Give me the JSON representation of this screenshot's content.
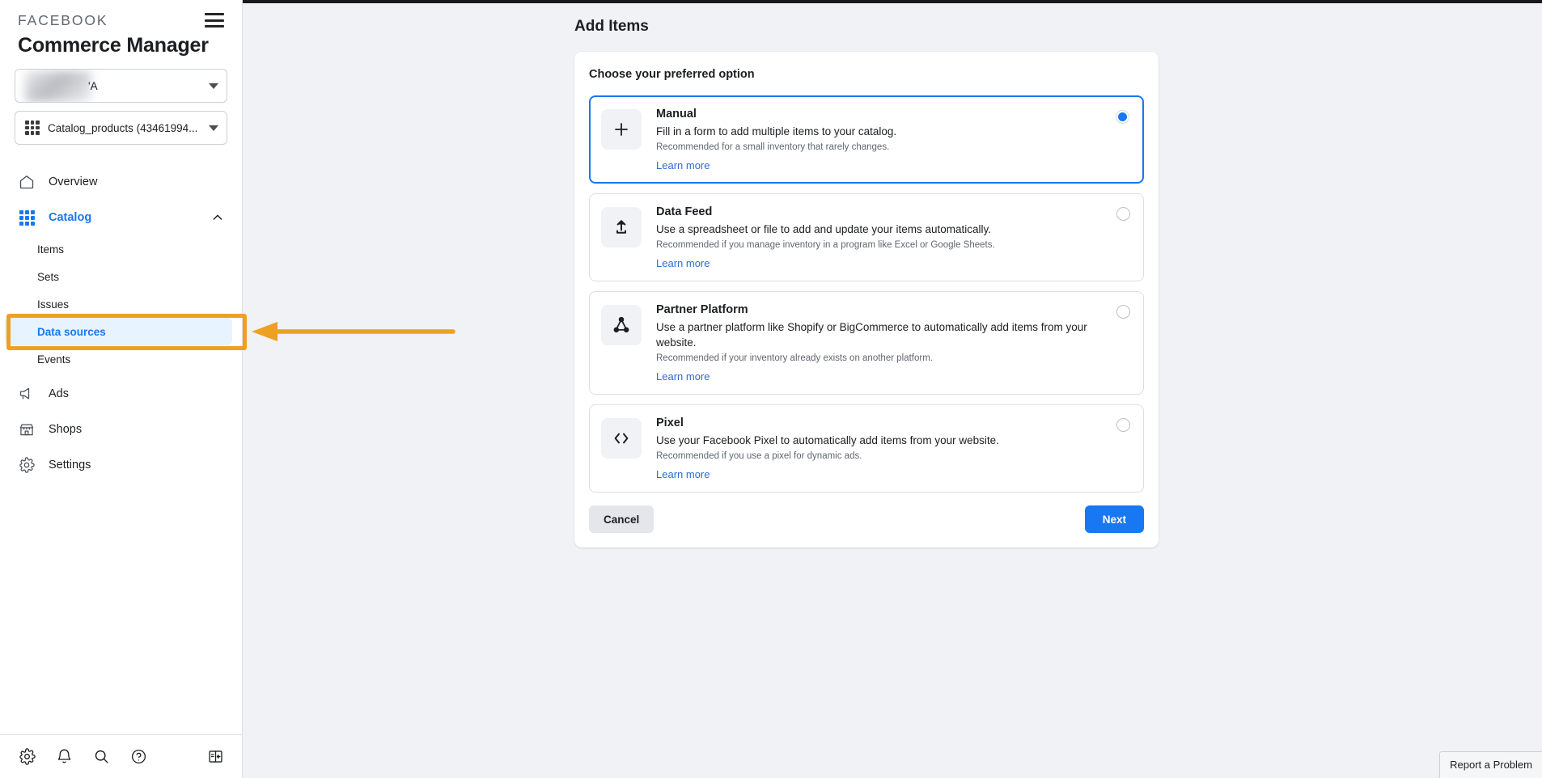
{
  "sidebar": {
    "brand": "FACEBOOK",
    "app_title": "Commerce Manager",
    "menu_icon": "hamburger-icon",
    "account_selector": {
      "value": "'A",
      "icon": "avatar-blurred"
    },
    "catalog_selector": {
      "value": "Catalog_products (43461994...",
      "icon": "grid-icon"
    },
    "nav": [
      {
        "label": "Overview",
        "icon": "home-icon",
        "active": false
      },
      {
        "label": "Catalog",
        "icon": "grid-icon",
        "active": true,
        "expanded": true,
        "chevron": "chevron-up-icon"
      },
      {
        "label": "Ads",
        "icon": "megaphone-icon",
        "active": false
      },
      {
        "label": "Shops",
        "icon": "storefront-icon",
        "active": false
      },
      {
        "label": "Settings",
        "icon": "gear-icon",
        "active": false
      }
    ],
    "catalog_subnav": [
      {
        "label": "Items",
        "selected": false
      },
      {
        "label": "Sets",
        "selected": false
      },
      {
        "label": "Issues",
        "selected": false
      },
      {
        "label": "Data sources",
        "selected": true
      },
      {
        "label": "Events",
        "selected": false
      }
    ],
    "footer_icons": [
      {
        "name": "gear-icon"
      },
      {
        "name": "bell-icon"
      },
      {
        "name": "search-icon"
      },
      {
        "name": "help-circle-icon"
      },
      {
        "name": "collapse-panel-icon"
      }
    ]
  },
  "main": {
    "page_title": "Add Items",
    "card_heading": "Choose your preferred option",
    "options": [
      {
        "id": "manual",
        "title": "Manual",
        "description": "Fill in a form to add multiple items to your catalog.",
        "recommendation": "Recommended for a small inventory that rarely changes.",
        "learn_more": "Learn more",
        "icon": "plus-icon",
        "selected": true
      },
      {
        "id": "data-feed",
        "title": "Data Feed",
        "description": "Use a spreadsheet or file to add and update your items automatically.",
        "recommendation": "Recommended if you manage inventory in a program like Excel or Google Sheets.",
        "learn_more": "Learn more",
        "icon": "upload-icon",
        "selected": false
      },
      {
        "id": "partner-platform",
        "title": "Partner Platform",
        "description": "Use a partner platform like Shopify or BigCommerce to automatically add items from your website.",
        "recommendation": "Recommended if your inventory already exists on another platform.",
        "learn_more": "Learn more",
        "icon": "network-nodes-icon",
        "selected": false
      },
      {
        "id": "pixel",
        "title": "Pixel",
        "description": "Use your Facebook Pixel to automatically add items from your website.",
        "recommendation": "Recommended if you use a pixel for dynamic ads.",
        "learn_more": "Learn more",
        "icon": "code-brackets-icon",
        "selected": false
      }
    ],
    "cancel_label": "Cancel",
    "next_label": "Next"
  },
  "footer": {
    "report_label": "Report a Problem"
  },
  "annotation": {
    "color": "#eda023",
    "target": "Data sources"
  },
  "colors": {
    "accent_blue": "#1877f2",
    "link_blue": "#2d6bd4",
    "selected_row_bg": "#e7f3ff",
    "page_bg": "#f0f2f5",
    "annotation_orange": "#eda023"
  }
}
